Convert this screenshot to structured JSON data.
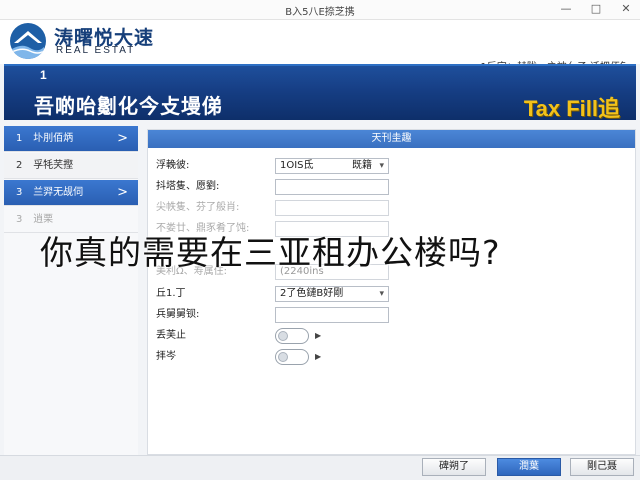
{
  "window": {
    "title": "B入5八E捺芝携",
    "minimize": "—",
    "maximize": "□",
    "close": "✕"
  },
  "logo": {
    "name": "涛曙悦大速",
    "subtitle": "REAL ESTAT"
  },
  "header": {
    "user_info": "1后字：赫陇、之神亻子·迁把佰钅"
  },
  "banner": {
    "step": "1",
    "heading": "吾啲咍劖化今攴墁俤",
    "brand": "Tax Fill追"
  },
  "sidebar": {
    "items": [
      {
        "num": "1",
        "label": "圤刖佰炳",
        "chevron": ">"
      },
      {
        "num": "2",
        "label": "孚牦芺摼",
        "chevron": ""
      },
      {
        "num": "3",
        "label": "兰羿无觇伺",
        "chevron": ">"
      },
      {
        "num": "3",
        "label": "逍栗",
        "chevron": ""
      }
    ]
  },
  "form": {
    "section_title": "天刊圭趣",
    "rows": [
      {
        "label": "浮輓彼:",
        "value": "1OIS氐",
        "option": "既籍"
      },
      {
        "label": "抖塔隻、愿劉:",
        "value": ""
      },
      {
        "label": "尖帙隻、芬了般肖:",
        "value": ""
      },
      {
        "label": "不娄廿、鼎豕肴了饨:",
        "value": ""
      },
      {
        "label": "美利Ω、寿属住:",
        "value": "(2240ins"
      },
      {
        "label": "丘1.丁",
        "value": "2了色鏈B好剛"
      },
      {
        "label": "兵舅舅钡:",
        "value": ""
      },
      {
        "label": "丢芙止",
        "arrow": "▶"
      },
      {
        "label": "拝岑",
        "arrow": "▶"
      }
    ]
  },
  "overlay": {
    "text": "你真的需要在三亚租办公楼吗?"
  },
  "footer": {
    "back": "碑朔了",
    "next": "潤葉",
    "cancel": "剛己聂"
  },
  "colors": {
    "banner": "#163e84",
    "accent": "#2f66bc",
    "brand_gold": "#f2c21b"
  }
}
